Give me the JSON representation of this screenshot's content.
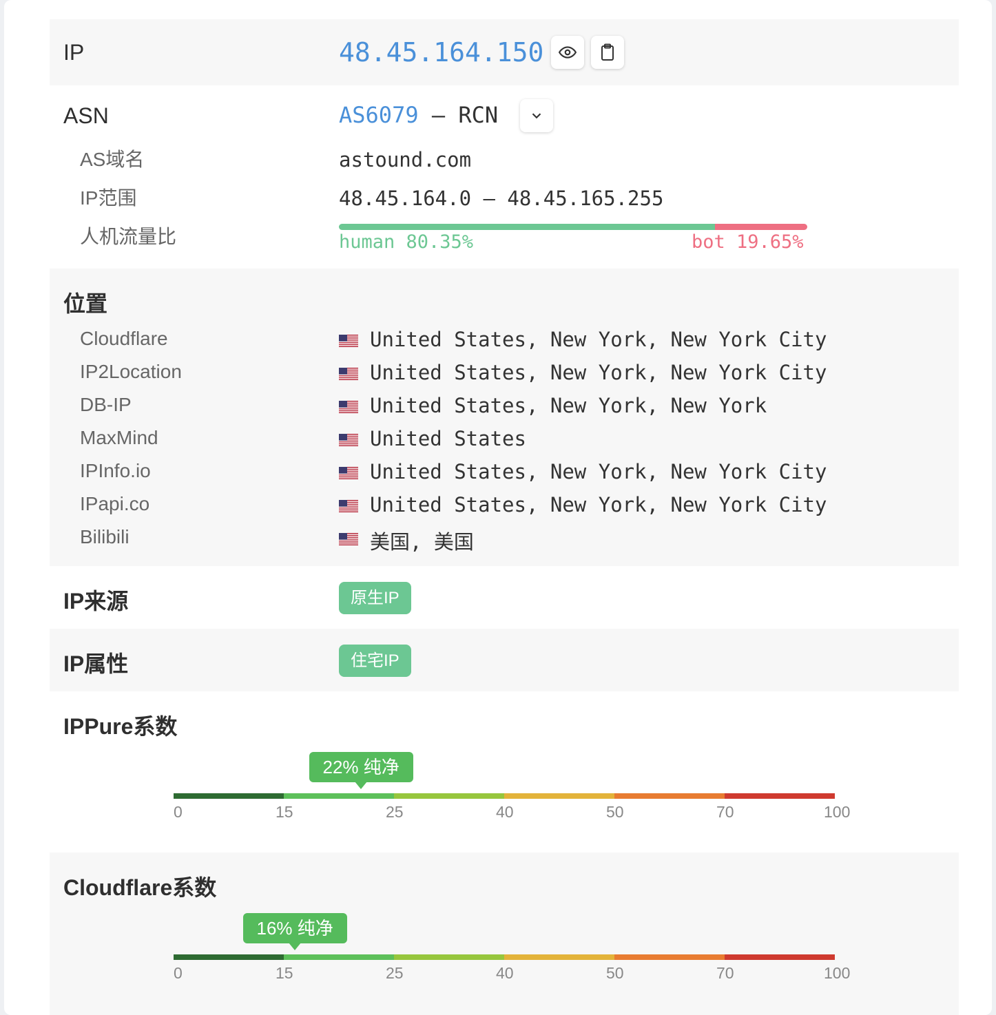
{
  "ip": {
    "label": "IP",
    "value": "48.45.164.150"
  },
  "icons": {
    "eye": "eye-icon",
    "copy": "clipboard-icon",
    "expand": "chevron-down-icon",
    "flag": "us-flag-icon"
  },
  "asn": {
    "label": "ASN",
    "number": "AS6079",
    "separator": " – ",
    "name": "RCN",
    "domain_label": "AS域名",
    "domain_value": "astound.com",
    "range_label": "IP范围",
    "range_value": "48.45.164.0 – 48.45.165.255",
    "ratio_label": "人机流量比",
    "human_text": "human 80.35%",
    "bot_text": "bot 19.65%",
    "human_percent": 80.35
  },
  "location": {
    "label": "位置",
    "sources": [
      {
        "name": "Cloudflare",
        "value": "United States, New York, New York City"
      },
      {
        "name": "IP2Location",
        "value": "United States, New York, New York City"
      },
      {
        "name": "DB-IP",
        "value": "United States, New York, New York"
      },
      {
        "name": "MaxMind",
        "value": "United States"
      },
      {
        "name": "IPInfo.io",
        "value": "United States, New York, New York City"
      },
      {
        "name": "IPapi.co",
        "value": "United States, New York, New York City"
      },
      {
        "name": "Bilibili",
        "value": "美国, 美国"
      }
    ]
  },
  "source": {
    "label": "IP来源",
    "tag": "原生IP"
  },
  "attribute": {
    "label": "IP属性",
    "tag": "住宅IP"
  },
  "ippure": {
    "label": "IPPure系数",
    "bubble": "22% 纯净",
    "score": 22
  },
  "cloudflare": {
    "label": "Cloudflare系数",
    "bubble": "16% 纯净",
    "score": 16
  },
  "scale_ticks": [
    "0",
    "15",
    "25",
    "40",
    "50",
    "70",
    "100"
  ],
  "colors": {
    "accent": "#4a90d9",
    "human": "#6cc793",
    "bot": "#ee6f82",
    "tag": "#6cc793",
    "bubble": "#55bb5c",
    "scale": [
      "#2e6b32",
      "#5dc05a",
      "#97c63d",
      "#e3b33a",
      "#e87c31",
      "#cf3a2f"
    ]
  }
}
